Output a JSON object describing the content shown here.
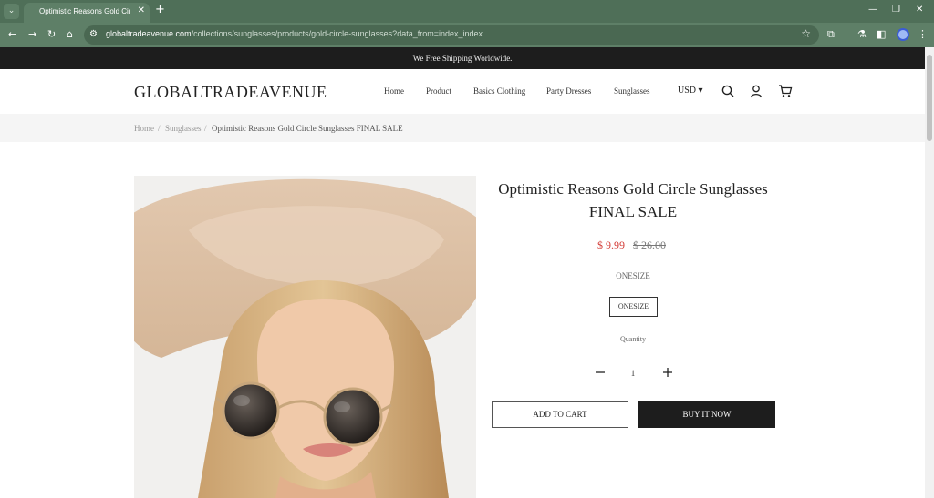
{
  "browser": {
    "tab_menu_glyph": "⌄",
    "tab_title": "Optimistic Reasons Gold Circle",
    "tab_close": "✕",
    "new_tab": "+",
    "url_host": "globaltradeavenue.com",
    "url_path": "/collections/sunglasses/products/gold-circle-sunglasses?data_from=index_index",
    "window_controls": {
      "minimize": "—",
      "restore": "❐",
      "close": "✕"
    }
  },
  "announcement": "We Free Shipping Worldwide.",
  "header": {
    "logo": "GLOBALTRADEAVENUE",
    "nav": [
      "Home",
      "Product",
      "Basics Clothing",
      "Party Dresses",
      "Sunglasses"
    ],
    "currency": "USD ▾"
  },
  "breadcrumb": {
    "home": "Home",
    "sep1": "/",
    "collection": "Sunglasses",
    "sep2": "/",
    "current": "Optimistic Reasons Gold Circle Sunglasses FINAL SALE"
  },
  "product": {
    "title": "Optimistic Reasons Gold Circle Sunglasses FINAL SALE",
    "price": "$ 9.99",
    "compare_price": "$ 26.00",
    "option_label": "ONESIZE",
    "option_value": "ONESIZE",
    "quantity_label": "Quantity",
    "quantity": "1",
    "add_to_cart": "ADD TO CART",
    "buy_now": "BUY IT NOW"
  },
  "colors": {
    "chrome": "#5e7f67",
    "announcement_bg": "#1d1d1d",
    "price": "#d43f3a",
    "buy_button": "#1d1d1d"
  }
}
